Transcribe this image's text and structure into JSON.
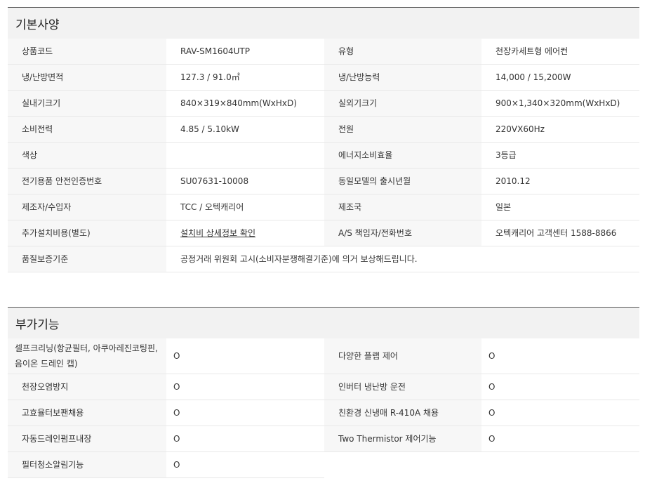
{
  "basic": {
    "title": "기본사양",
    "rows": [
      {
        "l1": "상품코드",
        "v1": "RAV-SM1604UTP",
        "l2": "유형",
        "v2": "천장카세트형 에어컨"
      },
      {
        "l1": "냉/난방면적",
        "v1": "127.3 / 91.0㎡",
        "l2": "냉/난방능력",
        "v2": "14,000 / 15,200W"
      },
      {
        "l1": "실내기크기",
        "v1": "840×319×840mm(WxHxD)",
        "l2": "실외기크기",
        "v2": "900×1,340×320mm(WxHxD)"
      },
      {
        "l1": "소비전력",
        "v1": "4.85 / 5.10kW",
        "l2": "전원",
        "v2": "220VX60Hz"
      },
      {
        "l1": "색상",
        "v1": "",
        "l2": "에너지소비효율",
        "v2": "3등급"
      },
      {
        "l1": "전기용품 안전인증번호",
        "v1": "SU07631-10008",
        "l2": "동일모델의 출시년월",
        "v2": "2010.12"
      },
      {
        "l1": "제조자/수입자",
        "v1": "TCC / 오텍캐리어",
        "l2": "제조국",
        "v2": "일본"
      },
      {
        "l1": "추가설치비용(별도)",
        "v1": "설치비 상세정보 확인",
        "l2": "A/S 책임자/전화번호",
        "v2": "오텍캐리어 고객센터 1588-8866"
      }
    ],
    "warranty": {
      "label": "품질보증기준",
      "value": "공정거래 위원회 고시(소비자분쟁해결기준)에 의거 보상해드립니다."
    }
  },
  "extra": {
    "title": "부가기능",
    "rows": [
      {
        "l1": "셀프크리닝(항균필터, 아쿠아레진코팅핀, 음이온 드레인 캡)",
        "v1": "O",
        "l2": "다양한 플랩 제어",
        "v2": "O"
      },
      {
        "l1": "천장오염방지",
        "v1": "O",
        "l2": "인버터 냉난방 운전",
        "v2": "O"
      },
      {
        "l1": "고효율터보팬채용",
        "v1": "O",
        "l2": "친환경 신냉매 R-410A 채용",
        "v2": "O"
      },
      {
        "l1": "자동드레인펌프내장",
        "v1": "O",
        "l2": "Two Thermistor 제어기능",
        "v2": "O"
      }
    ],
    "last": {
      "label": "필터청소알림기능",
      "value": "O"
    }
  }
}
